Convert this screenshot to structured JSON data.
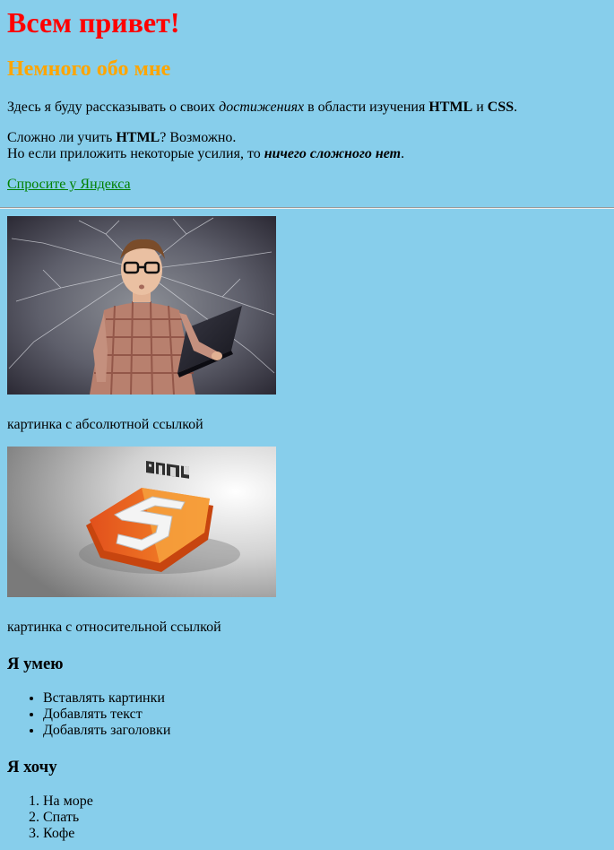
{
  "title": "Всем привет!",
  "subtitle": "Немного обо мне",
  "intro": {
    "before": "Здесь я буду рассказывать о своих ",
    "em": "достижениях",
    "middle": " в области изучения ",
    "strong1": "HTML",
    "and": " и ",
    "strong2": "CSS",
    "end": "."
  },
  "question": {
    "before": "Сложно ли учить ",
    "strong": "HTML",
    "after": "? Возможно.",
    "line2_before": "Но если приложить некоторые усилия, то ",
    "line2_emph": "ничего сложного нет",
    "line2_end": "."
  },
  "link_text": "Спросите у Яндекса",
  "images": [
    {
      "alt": "photo-person-with-laptop",
      "caption": "картинка с абсолютной ссылкой"
    },
    {
      "alt": "html5-logo-3d",
      "caption": "картинка с относительной ссылкой"
    }
  ],
  "can": {
    "heading": "Я умею",
    "items": [
      "Вставлять картинки",
      "Добавлять текст",
      "Добавлять заголовки"
    ]
  },
  "want": {
    "heading": "Я хочу",
    "items": [
      "На море",
      "Спать",
      "Кофе"
    ]
  },
  "colors": {
    "background": "#87ceeb",
    "h1": "#ff0000",
    "h2": "#ffa500",
    "link": "#008000"
  }
}
